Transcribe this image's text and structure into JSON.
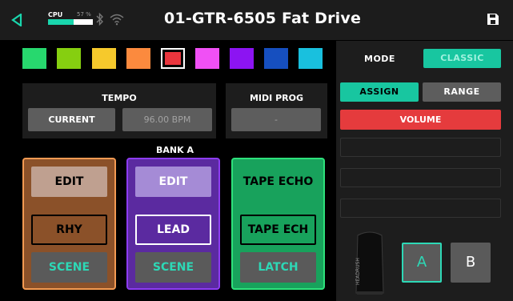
{
  "header": {
    "title": "01-GTR-6505 Fat Drive",
    "cpu_label": "CPU",
    "cpu_percent_text": "57 %",
    "cpu_level": 0.57,
    "icons": [
      "back-arrow-icon",
      "bluetooth-icon",
      "wifi-icon",
      "save-icon"
    ]
  },
  "swatches": [
    {
      "color": "#27d86e",
      "selected": false
    },
    {
      "color": "#86cf10",
      "selected": false
    },
    {
      "color": "#f6c92c",
      "selected": false
    },
    {
      "color": "#fb8a3e",
      "selected": false
    },
    {
      "color": "#e9353d",
      "selected": true
    },
    {
      "color": "#f050f5",
      "selected": false
    },
    {
      "color": "#8c14f2",
      "selected": false
    },
    {
      "color": "#164fbf",
      "selected": false
    },
    {
      "color": "#19c0de",
      "selected": false
    }
  ],
  "tempo": {
    "title": "TEMPO",
    "current_label": "CURRENT",
    "bpm_value": "96.00 BPM"
  },
  "midi": {
    "title": "MIDI PROG",
    "value": "-"
  },
  "bank": {
    "label": "BANK A"
  },
  "columns": [
    {
      "edit_label": "EDIT",
      "name": "RHY",
      "scene_label": "SCENE",
      "colors": {
        "bg": "#8b5129",
        "border": "#f39a52",
        "edit_bg": "#bfa090",
        "edit_text": "#000000",
        "mid_bg": "#8b5129",
        "mid_border": "#000000",
        "mid_text": "#000000"
      }
    },
    {
      "edit_label": "EDIT",
      "name": "LEAD",
      "scene_label": "SCENE",
      "colors": {
        "bg": "#5b2aa0",
        "border": "#8d3cf2",
        "edit_bg": "#a58bd6",
        "edit_text": "#ffffff",
        "mid_bg": "#5b2aa0",
        "mid_border": "#ffffff",
        "mid_text": "#ffffff"
      }
    },
    {
      "edit_label": "TAPE ECHO",
      "name": "TAPE ECH",
      "scene_label": "LATCH",
      "colors": {
        "bg": "#18a25c",
        "border": "#2ee17b",
        "edit_bg": "#18a25c",
        "edit_text": "#000000",
        "mid_bg": "#18a25c",
        "mid_border": "#000000",
        "mid_text": "#000000"
      }
    }
  ],
  "right_panel": {
    "mode_label": "MODE",
    "mode_value": "CLASSIC",
    "tabs": [
      "ASSIGN",
      "RANGE"
    ],
    "active_tab": "ASSIGN",
    "assigned_param": "VOLUME",
    "empty_slots": 3,
    "pedal_brand": "HEADRUSH",
    "a_label": "A",
    "b_label": "B",
    "active_ab": "A"
  },
  "colors": {
    "accent": "#19d6ad",
    "volume_red": "#e53b3d",
    "panel": "#1d1d1d",
    "button_gray": "#5d5d5d"
  }
}
